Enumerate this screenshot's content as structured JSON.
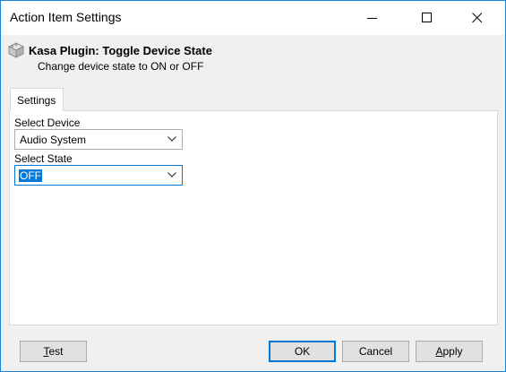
{
  "window": {
    "title": "Action Item Settings"
  },
  "header": {
    "plugin_title": "Kasa Plugin: Toggle Device State",
    "plugin_description": "Change device state to ON or OFF"
  },
  "tabs": [
    {
      "label": "Settings",
      "active": true
    }
  ],
  "settings": {
    "device_label": "Select Device",
    "device_value": "Audio System",
    "state_label": "Select State",
    "state_value": "OFF"
  },
  "buttons": {
    "test_first": "T",
    "test_rest": "est",
    "ok": "OK",
    "cancel": "Cancel",
    "apply_first": "A",
    "apply_rest": "pply"
  },
  "icons": {
    "minimize": "minimize-icon",
    "maximize": "maximize-icon",
    "close": "close-icon",
    "plugin": "plugin-cube-icon",
    "dropdown": "chevron-down-icon"
  },
  "colors": {
    "accent": "#0078d7",
    "window_border": "#1883d7",
    "button_face": "#e1e1e1"
  }
}
